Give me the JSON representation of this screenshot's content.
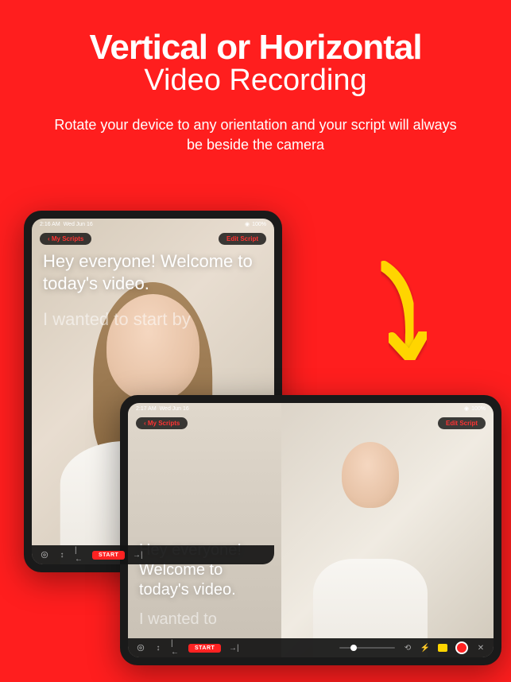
{
  "header": {
    "title_main": "Vertical or Horizontal",
    "title_sub": "Video Recording",
    "description": "Rotate your device to any orientation and your script will always be beside the camera"
  },
  "status": {
    "time_portrait": "2:16 AM",
    "time_landscape": "2:17 AM",
    "date": "Wed Jun 16",
    "battery": "100%"
  },
  "pills": {
    "left": "‹ My Scripts",
    "right": "Edit Script"
  },
  "script": {
    "primary": "Hey everyone! Welcome to today's video.",
    "secondary_portrait": "I wanted to start by",
    "secondary_landscape": "I wanted to"
  },
  "toolbar": {
    "start": "START"
  },
  "colors": {
    "background": "#FF1E1E",
    "arrow": "#FFD500",
    "accent_red": "#ff2222"
  }
}
